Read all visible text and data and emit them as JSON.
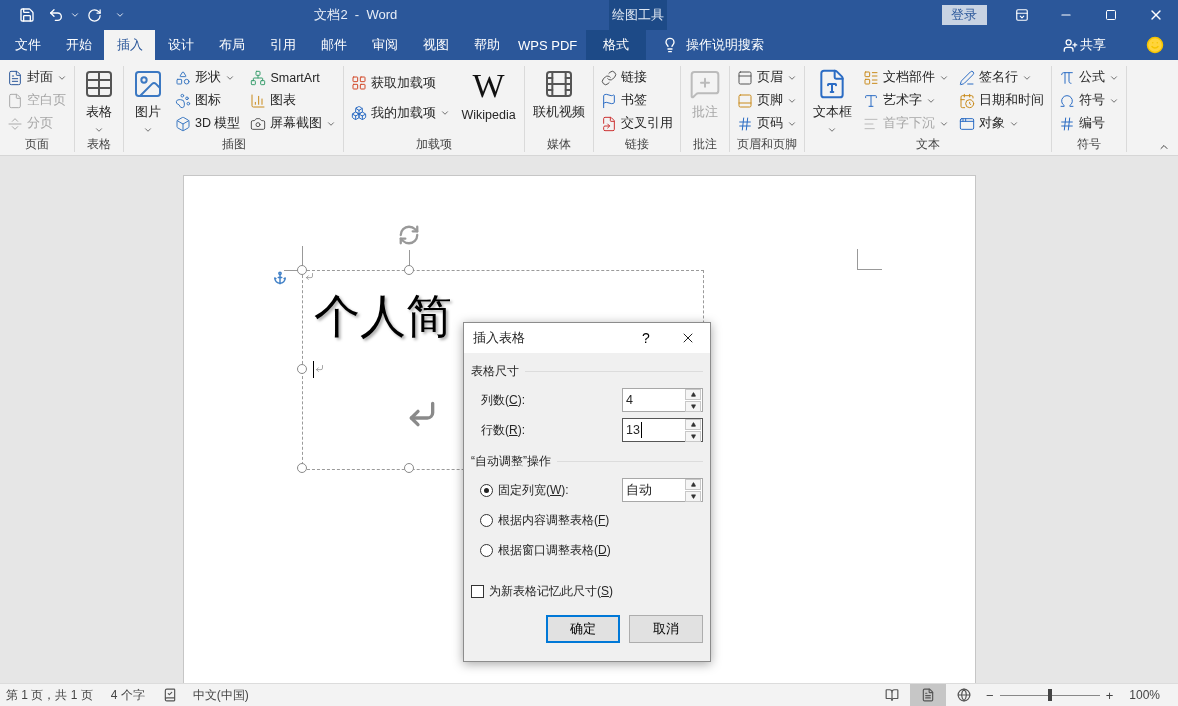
{
  "title_bar": {
    "title": "文档2  -  Word",
    "context_label": "绘图工具",
    "login": "登录"
  },
  "tabs": [
    {
      "label": "文件",
      "selected": false,
      "kind": "normal"
    },
    {
      "label": "开始",
      "selected": false,
      "kind": "normal"
    },
    {
      "label": "插入",
      "selected": true,
      "kind": "normal"
    },
    {
      "label": "设计",
      "selected": false,
      "kind": "normal"
    },
    {
      "label": "布局",
      "selected": false,
      "kind": "normal"
    },
    {
      "label": "引用",
      "selected": false,
      "kind": "normal"
    },
    {
      "label": "邮件",
      "selected": false,
      "kind": "normal"
    },
    {
      "label": "审阅",
      "selected": false,
      "kind": "normal"
    },
    {
      "label": "视图",
      "selected": false,
      "kind": "normal"
    },
    {
      "label": "帮助",
      "selected": false,
      "kind": "normal"
    },
    {
      "label": "WPS PDF",
      "selected": false,
      "kind": "normal"
    },
    {
      "label": "格式",
      "selected": false,
      "kind": "context"
    }
  ],
  "tell_me": "操作说明搜索",
  "share": "共享",
  "ribbon": {
    "groups": [
      {
        "label": "页面",
        "columns": [
          {
            "kind": "stack",
            "items": [
              {
                "label": "封面",
                "caret": true,
                "disabled": false
              },
              {
                "label": "空白页",
                "caret": false,
                "disabled": true
              },
              {
                "label": "分页",
                "caret": false,
                "disabled": true
              }
            ]
          }
        ]
      },
      {
        "label": "表格",
        "columns": [
          {
            "kind": "large",
            "items": [
              {
                "label": "表格",
                "caret": true,
                "disabled": false
              }
            ]
          }
        ]
      },
      {
        "label": "插图",
        "columns": [
          {
            "kind": "large",
            "items": [
              {
                "label": "图片",
                "caret": true,
                "disabled": false
              }
            ]
          },
          {
            "kind": "stack",
            "items": [
              {
                "label": "形状",
                "caret": true,
                "disabled": false
              },
              {
                "label": "图标",
                "caret": false,
                "disabled": false
              },
              {
                "label": "3D 模型",
                "caret": false,
                "disabled": false
              }
            ]
          },
          {
            "kind": "stack",
            "items": [
              {
                "label": "SmartArt",
                "caret": false,
                "disabled": false
              },
              {
                "label": "图表",
                "caret": false,
                "disabled": false
              },
              {
                "label": "屏幕截图",
                "caret": true,
                "disabled": false
              }
            ]
          }
        ]
      },
      {
        "label": "加载项",
        "columns": [
          {
            "kind": "stack2",
            "items": [
              {
                "label": "获取加载项",
                "caret": false,
                "disabled": false
              },
              {
                "label": "我的加载项",
                "caret": true,
                "disabled": false
              }
            ]
          },
          {
            "kind": "large",
            "items": [
              {
                "label": "Wikipedia",
                "caret": false,
                "disabled": false,
                "glyph": "W"
              }
            ]
          }
        ]
      },
      {
        "label": "媒体",
        "columns": [
          {
            "kind": "large",
            "items": [
              {
                "label": "联机视频",
                "caret": false,
                "disabled": false
              }
            ]
          }
        ]
      },
      {
        "label": "链接",
        "columns": [
          {
            "kind": "stack",
            "items": [
              {
                "label": "链接",
                "caret": false,
                "disabled": false
              },
              {
                "label": "书签",
                "caret": false,
                "disabled": false
              },
              {
                "label": "交叉引用",
                "caret": false,
                "disabled": false
              }
            ]
          }
        ]
      },
      {
        "label": "批注",
        "columns": [
          {
            "kind": "large",
            "items": [
              {
                "label": "批注",
                "caret": false,
                "disabled": true
              }
            ]
          }
        ]
      },
      {
        "label": "页眉和页脚",
        "columns": [
          {
            "kind": "stack",
            "items": [
              {
                "label": "页眉",
                "caret": true,
                "disabled": false
              },
              {
                "label": "页脚",
                "caret": true,
                "disabled": false
              },
              {
                "label": "页码",
                "caret": true,
                "disabled": false
              }
            ]
          }
        ]
      },
      {
        "label": "文本",
        "columns": [
          {
            "kind": "large",
            "items": [
              {
                "label": "文本框",
                "caret": true,
                "disabled": false
              }
            ]
          },
          {
            "kind": "stack",
            "items": [
              {
                "label": "文档部件",
                "caret": true,
                "disabled": false
              },
              {
                "label": "艺术字",
                "caret": true,
                "disabled": false
              },
              {
                "label": "首字下沉",
                "caret": true,
                "disabled": true
              }
            ]
          },
          {
            "kind": "stack",
            "items": [
              {
                "label": "签名行",
                "caret": true,
                "disabled": false
              },
              {
                "label": "日期和时间",
                "caret": false,
                "disabled": false
              },
              {
                "label": "对象",
                "caret": true,
                "disabled": false
              }
            ]
          }
        ]
      },
      {
        "label": "符号",
        "columns": [
          {
            "kind": "stack",
            "items": [
              {
                "label": "公式",
                "caret": true,
                "disabled": false
              },
              {
                "label": "符号",
                "caret": true,
                "disabled": false
              },
              {
                "label": "编号",
                "caret": false,
                "disabled": false
              }
            ]
          }
        ]
      }
    ]
  },
  "document": {
    "heading": "个人简"
  },
  "dialog": {
    "title": "插入表格",
    "help": "?",
    "size_section": "表格尺寸",
    "fields": [
      {
        "label": "列数(C):",
        "value": "4",
        "focused": false
      },
      {
        "label": "行数(R):",
        "value": "13",
        "focused": true
      }
    ],
    "autofit_section": "“自动调整”操作",
    "options": [
      {
        "label": "固定列宽(W):",
        "selected": true,
        "value": "自动"
      },
      {
        "label": "根据内容调整表格(F)",
        "selected": false
      },
      {
        "label": "根据窗口调整表格(D)",
        "selected": false
      }
    ],
    "remember": {
      "label": "为新表格记忆此尺寸(S)",
      "checked": false
    },
    "buttons": [
      {
        "label": "确定",
        "default": true
      },
      {
        "label": "取消",
        "default": false
      }
    ]
  },
  "status_bar": {
    "page": "第 1 页，共 1 页",
    "words": "4 个字",
    "language": "中文(中国)",
    "views": [
      {
        "selected": false
      },
      {
        "selected": true
      },
      {
        "selected": false
      }
    ],
    "zoom": {
      "minus": "−",
      "plus": "+",
      "level": 0.5,
      "reading": "100%"
    }
  }
}
